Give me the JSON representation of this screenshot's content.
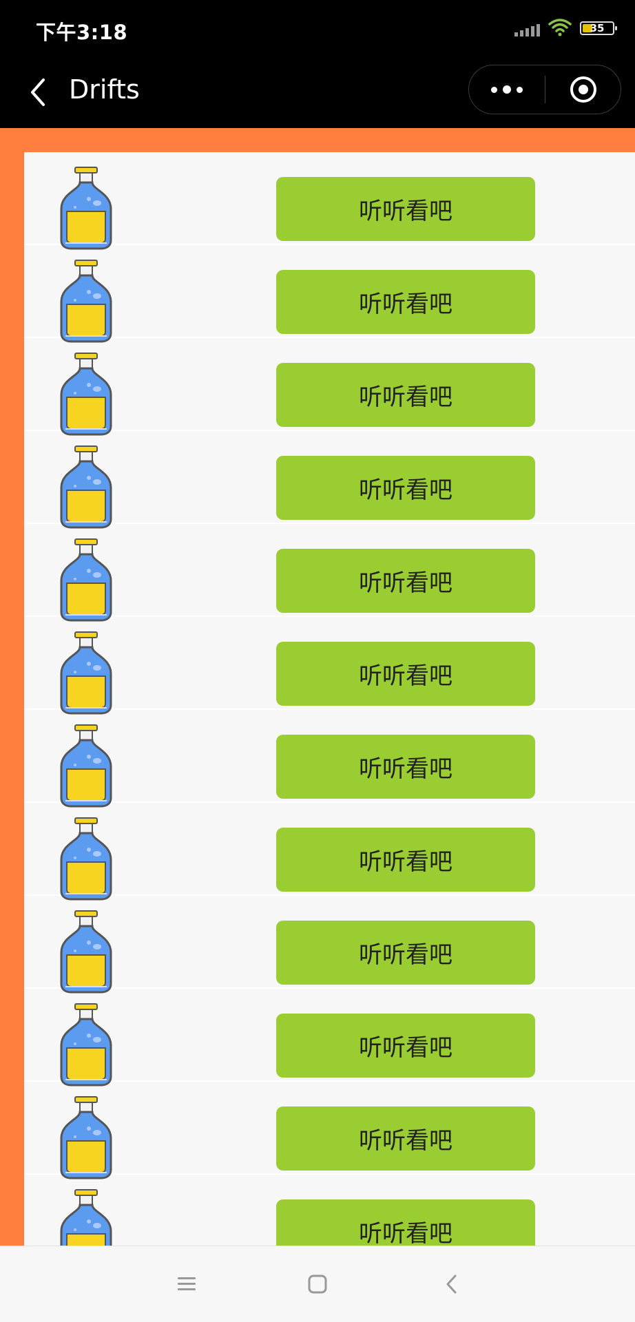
{
  "status_bar": {
    "time": "下午3:18",
    "battery": "35",
    "icons": [
      "signal-icon",
      "wifi-icon",
      "battery-icon"
    ]
  },
  "nav": {
    "title": "Drifts",
    "back_icon": "chevron-left-icon",
    "more_icon": "more-dots-icon",
    "close_icon": "target-close-icon"
  },
  "colors": {
    "background": "#ff7e40",
    "button": "#9acd32",
    "bottle_body": "#5b9bf0",
    "bottle_liquid": "#f7d420",
    "bottle_cap": "#f7d420"
  },
  "drifts": {
    "items": [
      {
        "icon": "bottle-icon",
        "button_label": "听听看吧"
      },
      {
        "icon": "bottle-icon",
        "button_label": "听听看吧"
      },
      {
        "icon": "bottle-icon",
        "button_label": "听听看吧"
      },
      {
        "icon": "bottle-icon",
        "button_label": "听听看吧"
      },
      {
        "icon": "bottle-icon",
        "button_label": "听听看吧"
      },
      {
        "icon": "bottle-icon",
        "button_label": "听听看吧"
      },
      {
        "icon": "bottle-icon",
        "button_label": "听听看吧"
      },
      {
        "icon": "bottle-icon",
        "button_label": "听听看吧"
      },
      {
        "icon": "bottle-icon",
        "button_label": "听听看吧"
      },
      {
        "icon": "bottle-icon",
        "button_label": "听听看吧"
      },
      {
        "icon": "bottle-icon",
        "button_label": "听听看吧"
      },
      {
        "icon": "bottle-icon",
        "button_label": "听听看吧"
      }
    ]
  },
  "system_nav": {
    "icons": [
      "menu-icon",
      "home-icon",
      "back-icon"
    ]
  }
}
